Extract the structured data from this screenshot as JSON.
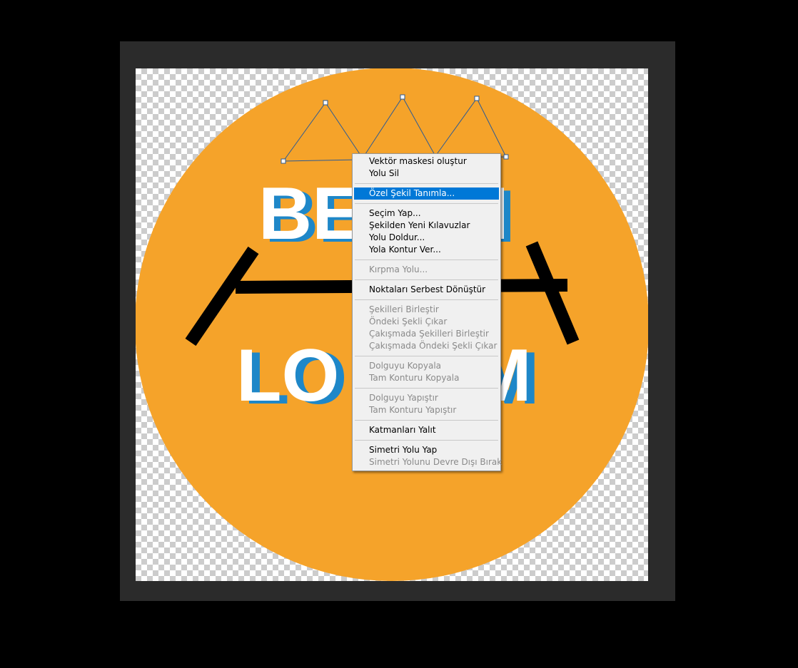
{
  "canvas": {
    "background": "transparent-checkerboard",
    "circle_color": "#f5a32a",
    "logo_text_line1_visible_left": "BE",
    "logo_text_line1_visible_right": "I",
    "logo_text_line2_visible_left": "LO",
    "logo_text_line2_visible_right": "M",
    "text_fill": "#ffffff",
    "text_shadow": "#1e87c8",
    "bar_color": "#000000",
    "path_color": "#1f4f8a"
  },
  "context_menu": {
    "groups": [
      [
        {
          "label": "Vektör maskesi oluştur",
          "enabled": true
        },
        {
          "label": "Yolu Sil",
          "enabled": true
        }
      ],
      [
        {
          "label": "Özel Şekil Tanımla...",
          "enabled": true,
          "highlighted": true
        }
      ],
      [
        {
          "label": "Seçim Yap...",
          "enabled": true
        },
        {
          "label": "Şekilden Yeni Kılavuzlar",
          "enabled": true
        },
        {
          "label": "Yolu Doldur...",
          "enabled": true
        },
        {
          "label": "Yola Kontur Ver...",
          "enabled": true
        }
      ],
      [
        {
          "label": "Kırpma Yolu...",
          "enabled": false
        }
      ],
      [
        {
          "label": "Noktaları Serbest Dönüştür",
          "enabled": true
        }
      ],
      [
        {
          "label": "Şekilleri Birleştir",
          "enabled": false
        },
        {
          "label": "Öndeki Şekli Çıkar",
          "enabled": false
        },
        {
          "label": "Çakışmada Şekilleri Birleştir",
          "enabled": false
        },
        {
          "label": "Çakışmada Öndeki Şekli Çıkar",
          "enabled": false
        }
      ],
      [
        {
          "label": "Dolguyu Kopyala",
          "enabled": false
        },
        {
          "label": "Tam Konturu Kopyala",
          "enabled": false
        }
      ],
      [
        {
          "label": "Dolguyu Yapıştır",
          "enabled": false
        },
        {
          "label": "Tam Konturu Yapıştır",
          "enabled": false
        }
      ],
      [
        {
          "label": "Katmanları Yalıt",
          "enabled": true
        }
      ],
      [
        {
          "label": "Simetri Yolu Yap",
          "enabled": true
        },
        {
          "label": "Simetri Yolunu Devre Dışı Bırak",
          "enabled": false
        }
      ]
    ]
  }
}
